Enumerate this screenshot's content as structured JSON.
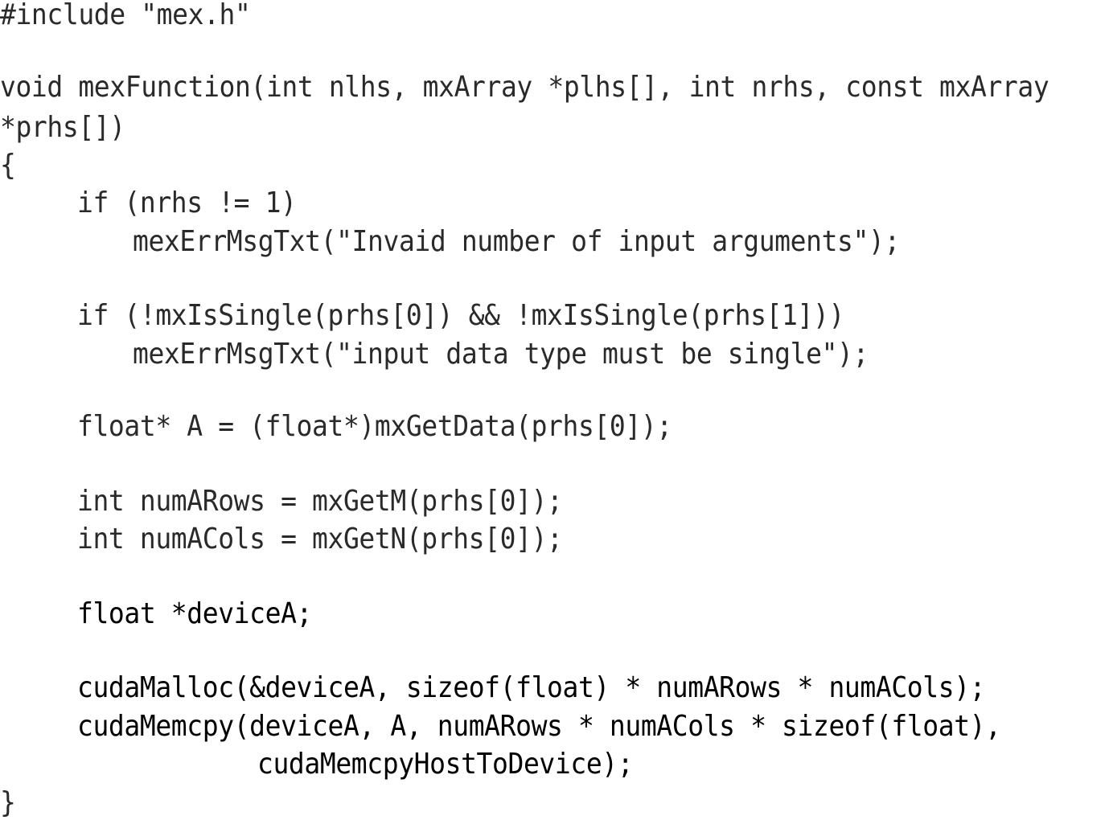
{
  "code_lines": [
    "#include \"mex.h\"",
    "void mexFunction(int nlhs, mxArray *plhs[], int nrhs, const mxArray",
    "*prhs[])",
    "{",
    "if (nrhs != 1)",
    "mexErrMsgTxt(\"Invaid number of input arguments\");",
    "if (!mxIsSingle(prhs[0]) && !mxIsSingle(prhs[1]))",
    "mexErrMsgTxt(\"input data type must be single\");",
    "float* A = (float*)mxGetData(prhs[0]);",
    "int numARows = mxGetM(prhs[0]);",
    "int numACols = mxGetN(prhs[0]);",
    "float *deviceA;",
    "cudaMalloc(&deviceA, sizeof(float) * numARows * numACols);",
    "cudaMemcpy(deviceA, A, numARows * numACols * sizeof(float),",
    "cudaMemcpyHostToDevice);",
    "}"
  ]
}
